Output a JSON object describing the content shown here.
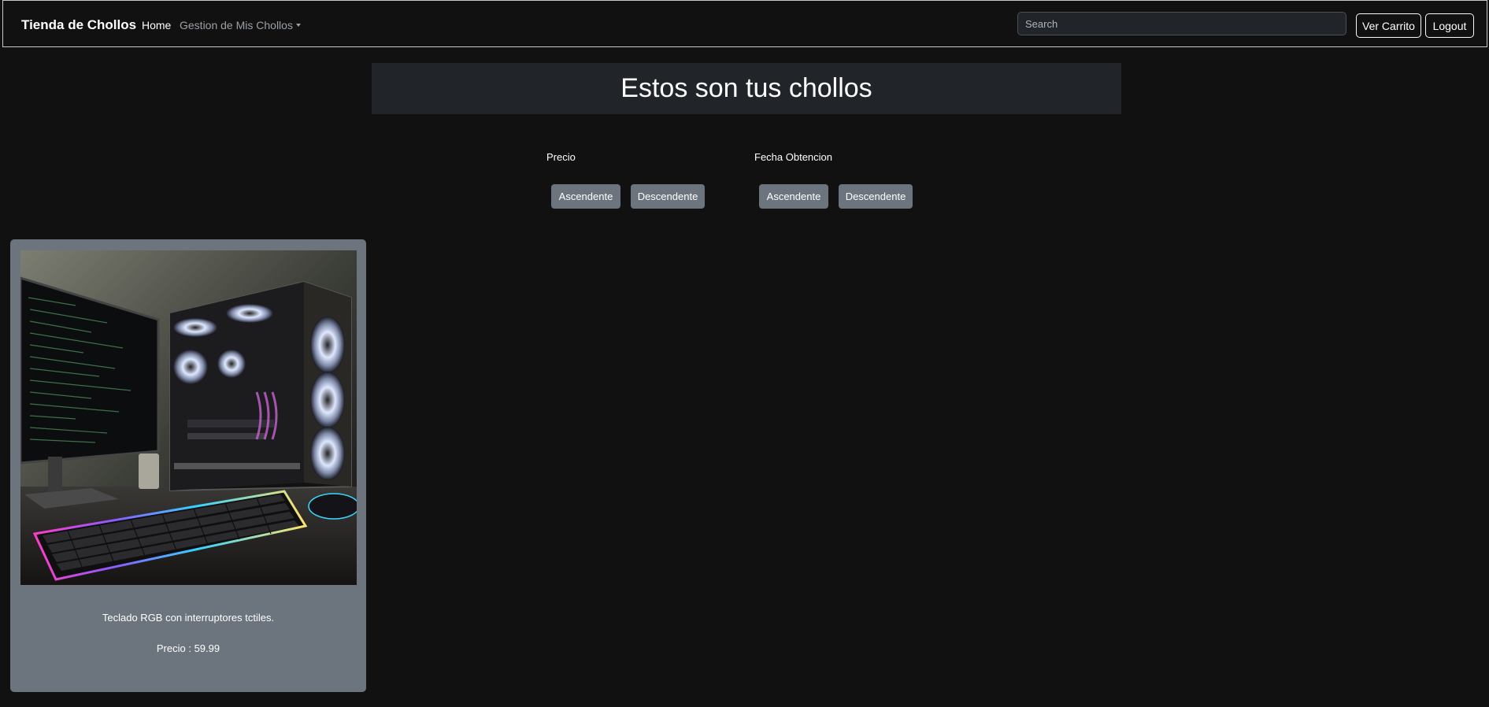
{
  "navbar": {
    "brand": "Tienda de Chollos",
    "home": "Home",
    "dropdown_label": "Gestion de Mis Chollos",
    "search_placeholder": "Search",
    "ver_carrito": "Ver Carrito",
    "logout": "Logout"
  },
  "header": {
    "title": "Estos son tus chollos"
  },
  "sorting": {
    "precio": {
      "label": "Precio",
      "asc": "Ascendente",
      "desc": "Descendente"
    },
    "fecha": {
      "label": "Fecha Obtencion",
      "asc": "Ascendente",
      "desc": "Descendente"
    }
  },
  "products": [
    {
      "description": "Teclado RGB con interruptores tctiles.",
      "price": "Precio : 59.99",
      "image_icon": "gaming-pc-keyboard-photo"
    }
  ],
  "colors": {
    "background": "#111112",
    "header_bg": "#212529",
    "card_bg": "#6c757d",
    "button_secondary": "#6c757d"
  }
}
